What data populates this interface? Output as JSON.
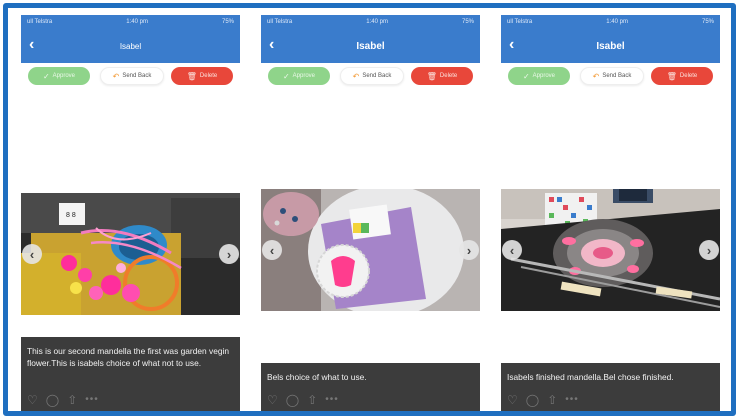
{
  "colors": {
    "frame": "#1f6fc0",
    "navbar": "#3a7ccc",
    "approve": "#8fd48a",
    "delete": "#e8473a",
    "caption_bg": "#3c3c3c"
  },
  "phones": [
    {
      "status_left": "ull Telstra",
      "status_time": "1:40 pm",
      "status_right": "75%",
      "title": "Isabel",
      "approve_label": "Approve",
      "sendback_label": "Send Back",
      "delete_label": "Delete",
      "caption": "This is our second mandella the first was garden vegin flower.This is isabels choice of what not to use."
    },
    {
      "status_left": "ull Telstra",
      "status_time": "1:40 pm",
      "status_right": "75%",
      "title": "Isabel",
      "approve_label": "Approve",
      "sendback_label": "Send Back",
      "delete_label": "Delete",
      "caption": "Bels choice of what to use."
    },
    {
      "status_left": "ull Telstra",
      "status_time": "1:40 pm",
      "status_right": "75%",
      "title": "Isabel",
      "approve_label": "Approve",
      "sendback_label": "Send Back",
      "delete_label": "Delete",
      "caption": "Isabels finished mandella.Bel chose finished."
    }
  ],
  "icons": {
    "back": "chevron-left-icon",
    "approve": "check-icon",
    "sendback": "undo-icon",
    "delete": "trash-icon",
    "prev": "chevron-left-icon",
    "next": "chevron-right-icon",
    "like": "heart-icon",
    "comment": "comment-icon",
    "share": "share-icon",
    "more": "more-icon"
  }
}
